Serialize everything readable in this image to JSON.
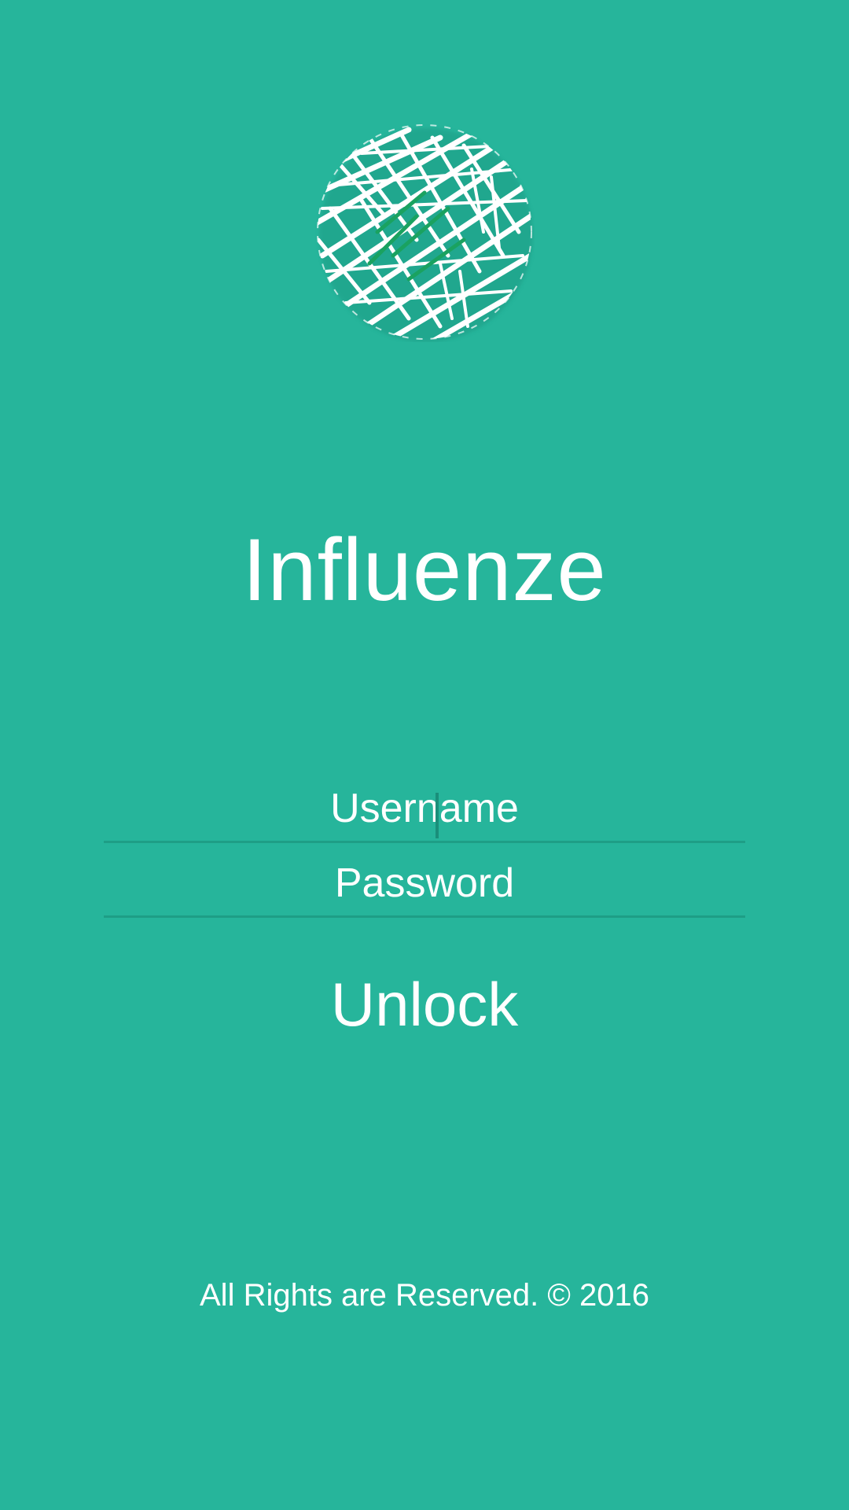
{
  "app": {
    "title": "Influenze"
  },
  "login": {
    "username_placeholder": "Username",
    "password_placeholder": "Password",
    "unlock_label": "Unlock"
  },
  "footer": {
    "copyright": "All Rights are Reserved. © 2016"
  },
  "logo": {
    "icon": "scribble-globe-logo"
  },
  "colors": {
    "background": "#26b59b",
    "underline": "#1e9e86",
    "text": "#ffffff",
    "logo_accent": "#1aa260"
  }
}
